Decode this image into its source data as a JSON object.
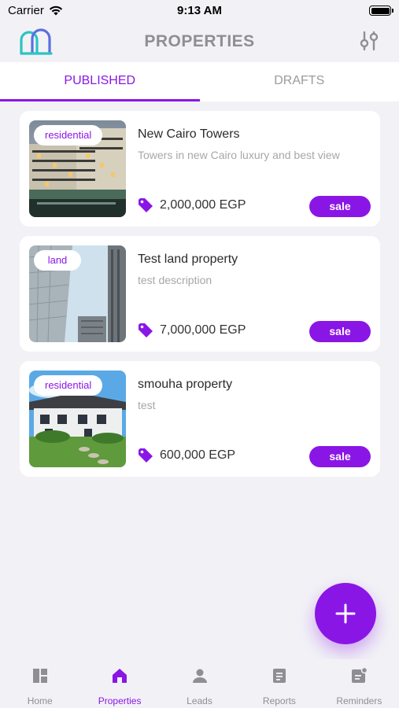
{
  "status_bar": {
    "carrier": "Carrier",
    "time": "9:13 AM"
  },
  "header": {
    "title": "PROPERTIES"
  },
  "tabs": [
    {
      "label": "PUBLISHED",
      "active": true
    },
    {
      "label": "DRAFTS",
      "active": false
    }
  ],
  "properties": [
    {
      "type": "residential",
      "title": "New Cairo Towers",
      "description": "Towers in new Cairo luxury and best view",
      "price": "2,000,000 EGP",
      "listing": "sale"
    },
    {
      "type": "land",
      "title": "Test land property",
      "description": "test description",
      "price": "7,000,000 EGP",
      "listing": "sale"
    },
    {
      "type": "residential",
      "title": "smouha property",
      "description": "test",
      "price": "600,000 EGP",
      "listing": "sale"
    }
  ],
  "bottom_nav": [
    {
      "label": "Home",
      "icon": "dashboard-icon",
      "active": false
    },
    {
      "label": "Properties",
      "icon": "house-icon",
      "active": true
    },
    {
      "label": "Leads",
      "icon": "person-icon",
      "active": false
    },
    {
      "label": "Reports",
      "icon": "report-icon",
      "active": false
    },
    {
      "label": "Reminders",
      "icon": "reminder-icon",
      "active": false
    }
  ],
  "colors": {
    "accent": "#8a16e6",
    "logo": "#2bc4c4",
    "muted": "#8e8e93"
  }
}
